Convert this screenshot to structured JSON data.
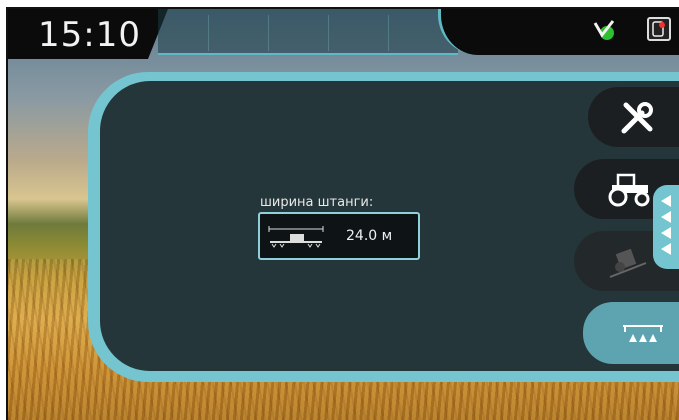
{
  "status_bar": {
    "time": "15:10",
    "status_icon": "ok-check-icon",
    "menu_icon": "display-menu-icon"
  },
  "main": {
    "boom_width_label": "ширина штанги:",
    "boom_width_value": "24.0 м"
  },
  "side_menu": {
    "items": [
      {
        "icon": "tools-icon"
      },
      {
        "icon": "tractor-icon"
      },
      {
        "icon": "tilt-calibration-icon",
        "disabled": true
      },
      {
        "icon": "sprayer-icon",
        "selected": true
      }
    ],
    "expand_icon": "expand-arrows-icon"
  },
  "colors": {
    "accent": "#74c5cf",
    "panel": "#121618",
    "selected": "#5ea3b0"
  }
}
